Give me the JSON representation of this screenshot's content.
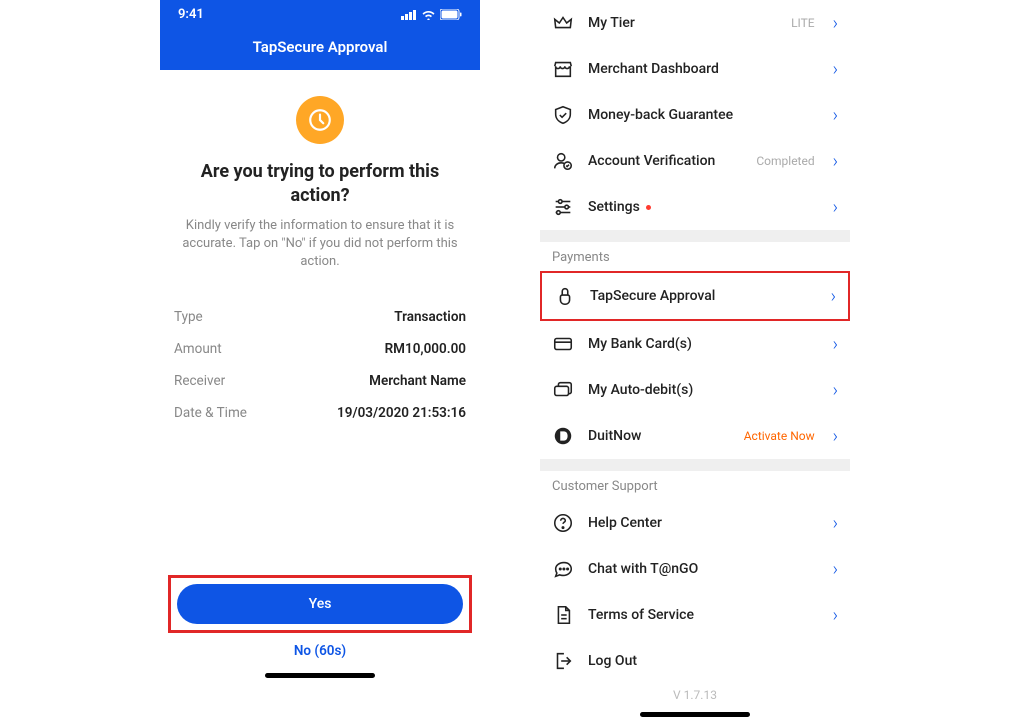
{
  "left": {
    "status_time": "9:41",
    "header_title": "TapSecure Approval",
    "question": "Are you trying to perform this action?",
    "subtext": "Kindly verify the information to ensure that it is accurate. Tap on \"No\" if you did not perform this action.",
    "details": {
      "type_label": "Type",
      "type_value": "Transaction",
      "amount_label": "Amount",
      "amount_value": "RM10,000.00",
      "receiver_label": "Receiver",
      "receiver_value": "Merchant Name",
      "datetime_label": "Date & Time",
      "datetime_value": "19/03/2020  21:53:16"
    },
    "yes_label": "Yes",
    "no_label": "No (60s)"
  },
  "right": {
    "rows": {
      "my_tier": "My Tier",
      "my_tier_extra": "LITE",
      "merchant_dashboard": "Merchant Dashboard",
      "money_back": "Money-back Guarantee",
      "account_verification": "Account Verification",
      "account_verification_extra": "Completed",
      "settings": "Settings",
      "tapsecure": "TapSecure Approval",
      "bank_cards": "My Bank Card(s)",
      "auto_debit": "My Auto-debit(s)",
      "duitnow": "DuitNow",
      "duitnow_extra": "Activate Now",
      "help_center": "Help Center",
      "chat": "Chat with T@nGO",
      "tos": "Terms of Service",
      "logout": "Log Out"
    },
    "section_payments": "Payments",
    "section_support": "Customer Support",
    "version": "V 1.7.13"
  }
}
